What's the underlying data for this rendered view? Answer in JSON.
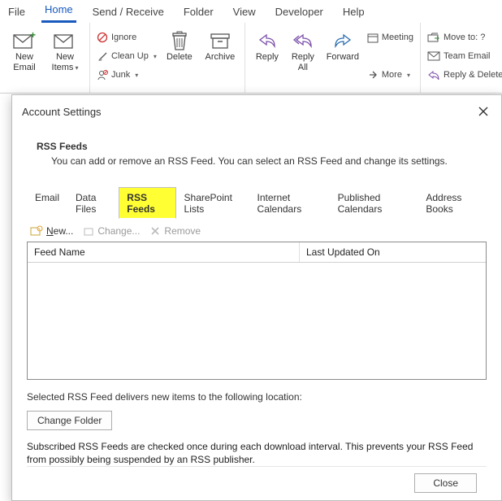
{
  "menubar": {
    "items": [
      "File",
      "Home",
      "Send / Receive",
      "Folder",
      "View",
      "Developer",
      "Help"
    ],
    "active_index": 1
  },
  "ribbon": {
    "new_email": "New\nEmail",
    "new_items": "New\nItems",
    "ignore": "Ignore",
    "clean_up": "Clean Up",
    "junk": "Junk",
    "delete": "Delete",
    "archive": "Archive",
    "reply": "Reply",
    "reply_all": "Reply\nAll",
    "forward": "Forward",
    "meeting": "Meeting",
    "more": "More",
    "move_to": "Move to: ?",
    "team_email": "Team Email",
    "reply_delete": "Reply & Delete"
  },
  "dialog": {
    "title": "Account Settings",
    "section_title": "RSS Feeds",
    "section_desc": "You can add or remove an RSS Feed. You can select an RSS Feed and change its settings.",
    "tabs": [
      "Email",
      "Data Files",
      "RSS Feeds",
      "SharePoint Lists",
      "Internet Calendars",
      "Published Calendars",
      "Address Books"
    ],
    "active_tab_index": 2,
    "toolbar": {
      "new": "New...",
      "change": "Change...",
      "remove": "Remove"
    },
    "columns": {
      "feed_name": "Feed Name",
      "last_updated": "Last Updated On"
    },
    "rows": [],
    "delivers_label": "Selected RSS Feed delivers new items to the following location:",
    "change_folder_btn": "Change Folder",
    "note": "Subscribed RSS Feeds are checked once during each download interval. This prevents your RSS Feed from possibly being suspended by an RSS publisher.",
    "close_btn": "Close"
  }
}
